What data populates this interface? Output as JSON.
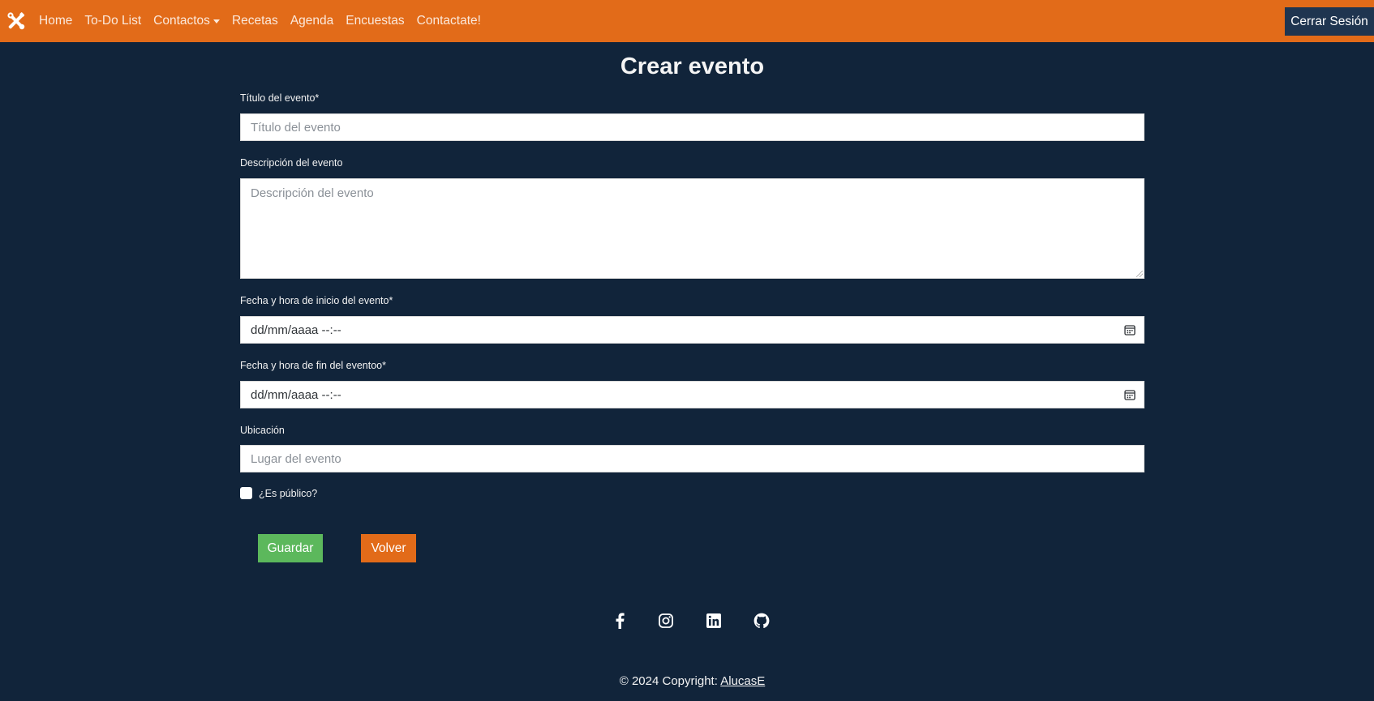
{
  "navbar": {
    "brand_icon": "tools-icon",
    "items": [
      {
        "label": "Home"
      },
      {
        "label": "To-Do List"
      },
      {
        "label": "Contactos",
        "dropdown": true
      },
      {
        "label": "Recetas"
      },
      {
        "label": "Agenda"
      },
      {
        "label": "Encuestas"
      },
      {
        "label": "Contactate!"
      }
    ],
    "logout_label": "Cerrar Sesión",
    "bg_color": "#e26b19"
  },
  "form": {
    "title": "Crear evento",
    "title_field": {
      "label": "Título del evento*",
      "placeholder": "Título del evento"
    },
    "description_field": {
      "label": "Descripción del evento",
      "placeholder": "Descripción del evento"
    },
    "start_field": {
      "label": "Fecha y hora de inicio del evento*",
      "value": "dd/mm/aaaa --:--",
      "icon": "calendar-icon"
    },
    "end_field": {
      "label": "Fecha y hora de fin del eventoo*",
      "value": "dd/mm/aaaa --:--",
      "icon": "calendar-icon"
    },
    "location_field": {
      "label": "Ubicación",
      "placeholder": "Lugar del evento"
    },
    "public_checkbox": {
      "label": "¿Es público?",
      "checked": false
    },
    "save_label": "Guardar",
    "back_label": "Volver"
  },
  "footer": {
    "social_icons": [
      "facebook-icon",
      "instagram-icon",
      "linkedin-icon",
      "github-icon"
    ],
    "copyright_prefix": "© 2024 Copyright: ",
    "copyright_link": "AlucasE"
  },
  "colors": {
    "background": "#11243a",
    "accent": "#e26b19",
    "success": "#5cb85c",
    "logout_bg": "#1f3550"
  }
}
